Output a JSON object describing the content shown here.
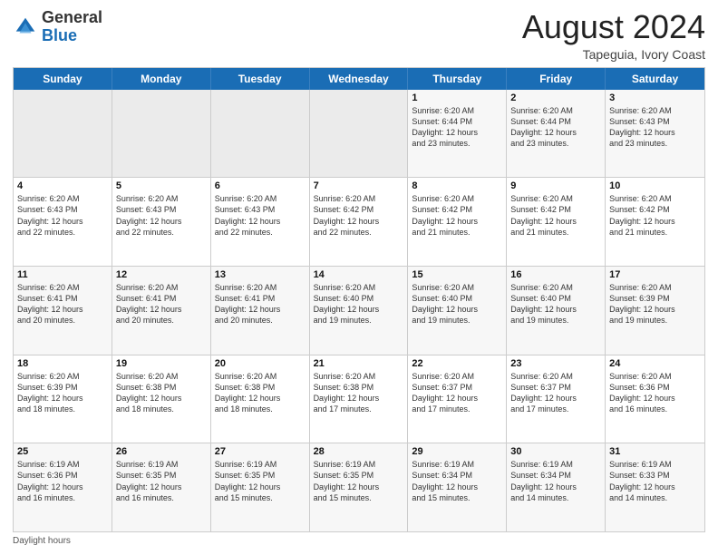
{
  "header": {
    "logo_general": "General",
    "logo_blue": "Blue",
    "main_title": "August 2024",
    "subtitle": "Tapeguia, Ivory Coast"
  },
  "calendar": {
    "days_of_week": [
      "Sunday",
      "Monday",
      "Tuesday",
      "Wednesday",
      "Thursday",
      "Friday",
      "Saturday"
    ],
    "rows": [
      [
        {
          "day": "",
          "info": ""
        },
        {
          "day": "",
          "info": ""
        },
        {
          "day": "",
          "info": ""
        },
        {
          "day": "",
          "info": ""
        },
        {
          "day": "1",
          "info": "Sunrise: 6:20 AM\nSunset: 6:44 PM\nDaylight: 12 hours\nand 23 minutes."
        },
        {
          "day": "2",
          "info": "Sunrise: 6:20 AM\nSunset: 6:44 PM\nDaylight: 12 hours\nand 23 minutes."
        },
        {
          "day": "3",
          "info": "Sunrise: 6:20 AM\nSunset: 6:43 PM\nDaylight: 12 hours\nand 23 minutes."
        }
      ],
      [
        {
          "day": "4",
          "info": "Sunrise: 6:20 AM\nSunset: 6:43 PM\nDaylight: 12 hours\nand 22 minutes."
        },
        {
          "day": "5",
          "info": "Sunrise: 6:20 AM\nSunset: 6:43 PM\nDaylight: 12 hours\nand 22 minutes."
        },
        {
          "day": "6",
          "info": "Sunrise: 6:20 AM\nSunset: 6:43 PM\nDaylight: 12 hours\nand 22 minutes."
        },
        {
          "day": "7",
          "info": "Sunrise: 6:20 AM\nSunset: 6:42 PM\nDaylight: 12 hours\nand 22 minutes."
        },
        {
          "day": "8",
          "info": "Sunrise: 6:20 AM\nSunset: 6:42 PM\nDaylight: 12 hours\nand 21 minutes."
        },
        {
          "day": "9",
          "info": "Sunrise: 6:20 AM\nSunset: 6:42 PM\nDaylight: 12 hours\nand 21 minutes."
        },
        {
          "day": "10",
          "info": "Sunrise: 6:20 AM\nSunset: 6:42 PM\nDaylight: 12 hours\nand 21 minutes."
        }
      ],
      [
        {
          "day": "11",
          "info": "Sunrise: 6:20 AM\nSunset: 6:41 PM\nDaylight: 12 hours\nand 20 minutes."
        },
        {
          "day": "12",
          "info": "Sunrise: 6:20 AM\nSunset: 6:41 PM\nDaylight: 12 hours\nand 20 minutes."
        },
        {
          "day": "13",
          "info": "Sunrise: 6:20 AM\nSunset: 6:41 PM\nDaylight: 12 hours\nand 20 minutes."
        },
        {
          "day": "14",
          "info": "Sunrise: 6:20 AM\nSunset: 6:40 PM\nDaylight: 12 hours\nand 19 minutes."
        },
        {
          "day": "15",
          "info": "Sunrise: 6:20 AM\nSunset: 6:40 PM\nDaylight: 12 hours\nand 19 minutes."
        },
        {
          "day": "16",
          "info": "Sunrise: 6:20 AM\nSunset: 6:40 PM\nDaylight: 12 hours\nand 19 minutes."
        },
        {
          "day": "17",
          "info": "Sunrise: 6:20 AM\nSunset: 6:39 PM\nDaylight: 12 hours\nand 19 minutes."
        }
      ],
      [
        {
          "day": "18",
          "info": "Sunrise: 6:20 AM\nSunset: 6:39 PM\nDaylight: 12 hours\nand 18 minutes."
        },
        {
          "day": "19",
          "info": "Sunrise: 6:20 AM\nSunset: 6:38 PM\nDaylight: 12 hours\nand 18 minutes."
        },
        {
          "day": "20",
          "info": "Sunrise: 6:20 AM\nSunset: 6:38 PM\nDaylight: 12 hours\nand 18 minutes."
        },
        {
          "day": "21",
          "info": "Sunrise: 6:20 AM\nSunset: 6:38 PM\nDaylight: 12 hours\nand 17 minutes."
        },
        {
          "day": "22",
          "info": "Sunrise: 6:20 AM\nSunset: 6:37 PM\nDaylight: 12 hours\nand 17 minutes."
        },
        {
          "day": "23",
          "info": "Sunrise: 6:20 AM\nSunset: 6:37 PM\nDaylight: 12 hours\nand 17 minutes."
        },
        {
          "day": "24",
          "info": "Sunrise: 6:20 AM\nSunset: 6:36 PM\nDaylight: 12 hours\nand 16 minutes."
        }
      ],
      [
        {
          "day": "25",
          "info": "Sunrise: 6:19 AM\nSunset: 6:36 PM\nDaylight: 12 hours\nand 16 minutes."
        },
        {
          "day": "26",
          "info": "Sunrise: 6:19 AM\nSunset: 6:35 PM\nDaylight: 12 hours\nand 16 minutes."
        },
        {
          "day": "27",
          "info": "Sunrise: 6:19 AM\nSunset: 6:35 PM\nDaylight: 12 hours\nand 15 minutes."
        },
        {
          "day": "28",
          "info": "Sunrise: 6:19 AM\nSunset: 6:35 PM\nDaylight: 12 hours\nand 15 minutes."
        },
        {
          "day": "29",
          "info": "Sunrise: 6:19 AM\nSunset: 6:34 PM\nDaylight: 12 hours\nand 15 minutes."
        },
        {
          "day": "30",
          "info": "Sunrise: 6:19 AM\nSunset: 6:34 PM\nDaylight: 12 hours\nand 14 minutes."
        },
        {
          "day": "31",
          "info": "Sunrise: 6:19 AM\nSunset: 6:33 PM\nDaylight: 12 hours\nand 14 minutes."
        }
      ]
    ]
  },
  "footer": {
    "daylight_hours_label": "Daylight hours"
  }
}
